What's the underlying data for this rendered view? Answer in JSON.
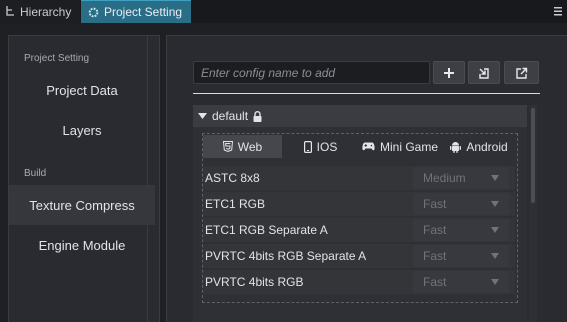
{
  "tabs": [
    {
      "label": "Hierarchy",
      "icon": "hierarchy-icon"
    },
    {
      "label": "Project Setting",
      "icon": "settings-gear-icon",
      "active": true
    }
  ],
  "sidebar": {
    "sections": [
      {
        "label": "Project Setting",
        "items": [
          {
            "label": "Project Data"
          },
          {
            "label": "Layers"
          }
        ]
      },
      {
        "label": "Build",
        "items": [
          {
            "label": "Texture Compress",
            "active": true
          },
          {
            "label": "Engine Module"
          }
        ]
      }
    ]
  },
  "config": {
    "placeholder": "Enter config name to add",
    "buttons": {
      "add": "plus-icon",
      "import": "import-icon",
      "export": "export-icon"
    }
  },
  "group": {
    "name": "default",
    "locked": true
  },
  "platform_tabs": [
    {
      "label": "Web",
      "icon": "html5-icon",
      "active": true
    },
    {
      "label": "IOS",
      "icon": "phone-icon"
    },
    {
      "label": "Mini Game",
      "icon": "gamepad-icon"
    },
    {
      "label": "Android",
      "icon": "android-icon"
    }
  ],
  "formats": [
    {
      "name": "ASTC 8x8",
      "quality": "Medium"
    },
    {
      "name": "ETC1 RGB",
      "quality": "Fast"
    },
    {
      "name": "ETC1 RGB Separate A",
      "quality": "Fast"
    },
    {
      "name": "PVRTC 4bits RGB Separate A",
      "quality": "Fast"
    },
    {
      "name": "PVRTC 4bits RGB",
      "quality": "Fast"
    }
  ],
  "colors": {
    "active_tab": "#2a6d86",
    "background": "#1f2024",
    "panel": "#2a2b30"
  }
}
